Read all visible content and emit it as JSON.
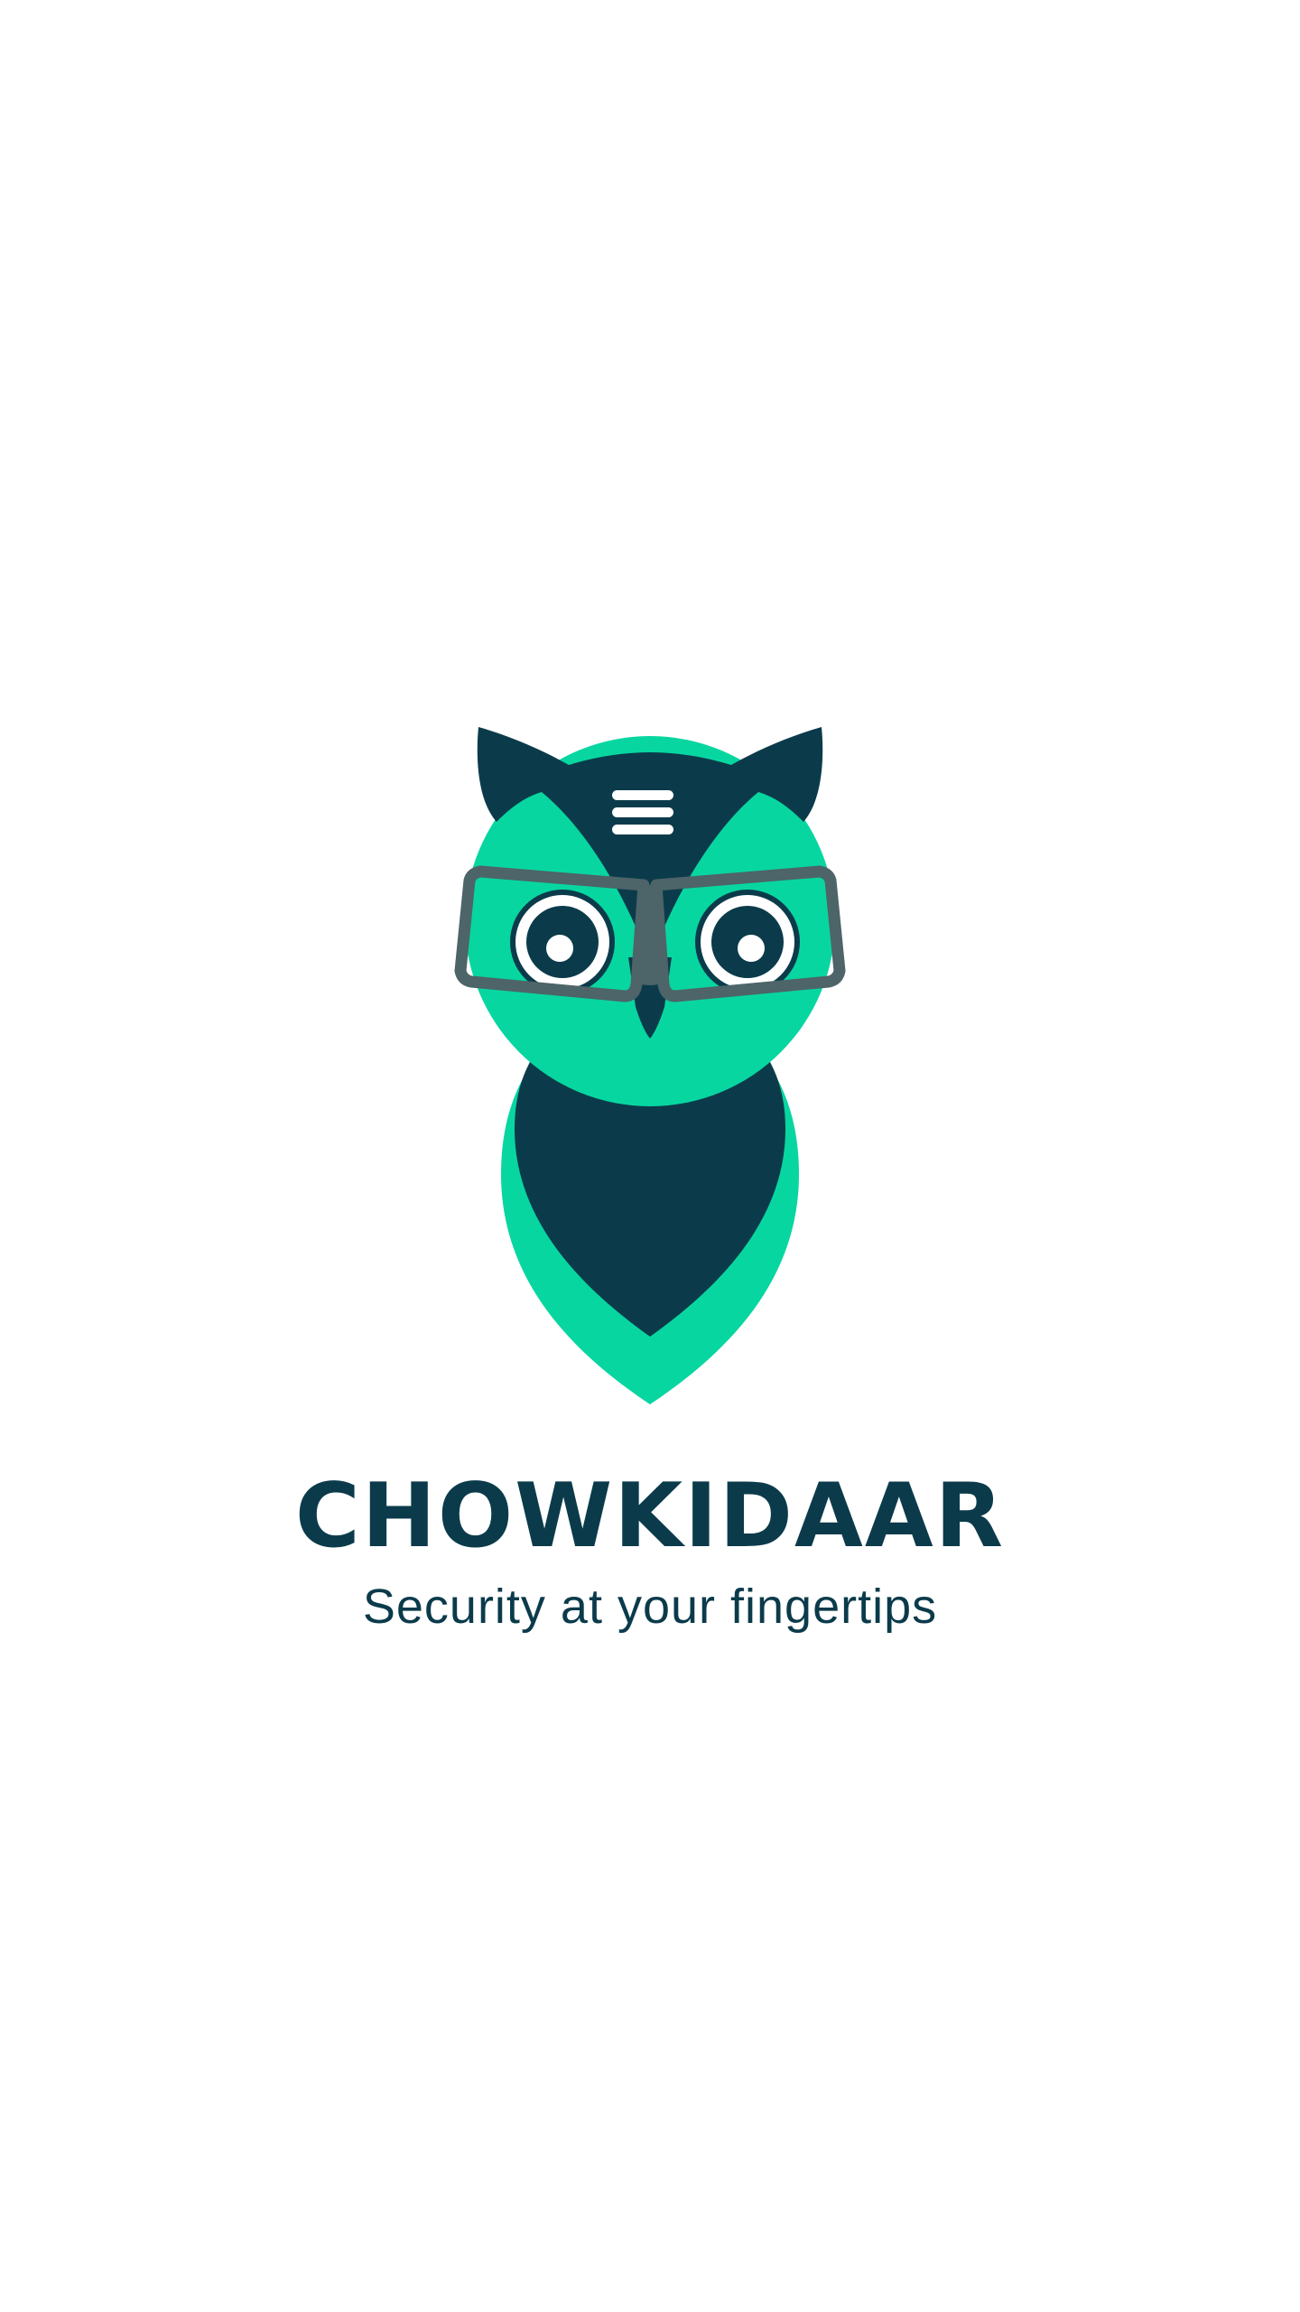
{
  "splash": {
    "app_name": "CHOWKIDAAR",
    "tagline": "Security at your fingertips"
  },
  "logo": {
    "icon": "owl-with-glasses-icon",
    "colors": {
      "teal_green": "#08d6a0",
      "dark_navy": "#0b3b4b",
      "glasses_gray": "#4d6468",
      "white": "#ffffff"
    }
  }
}
